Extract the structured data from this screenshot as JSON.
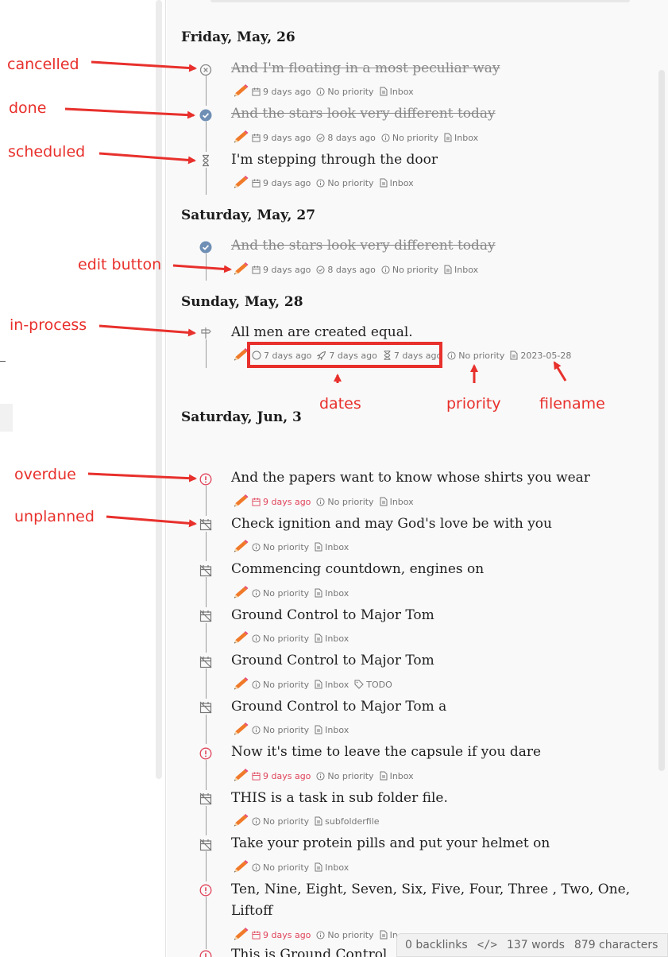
{
  "days": [
    {
      "heading": "Friday, May, 26"
    },
    {
      "heading": "Saturday, May, 27"
    },
    {
      "heading": "Sunday, May, 28"
    },
    {
      "heading": "Saturday, Jun, 3"
    }
  ],
  "tasks": [
    {
      "title": "And I'm floating in a most peculiar way",
      "status": "cancelled",
      "created": "9 days ago",
      "priority": "No priority",
      "file": "Inbox"
    },
    {
      "title": "And the stars look very different today",
      "status": "done",
      "created": "9 days ago",
      "completed": "8 days ago",
      "priority": "No priority",
      "file": "Inbox"
    },
    {
      "title": "I'm stepping through the door",
      "status": "scheduled",
      "created": "9 days ago",
      "priority": "No priority",
      "file": "Inbox"
    },
    {
      "title": "And the stars look very different today",
      "status": "done",
      "created": "9 days ago",
      "completed": "8 days ago",
      "priority": "No priority",
      "file": "Inbox"
    },
    {
      "title": "All men are created equal.",
      "status": "in-process",
      "created": "7 days ago",
      "start": "7 days ago",
      "scheduled": "7 days ago",
      "priority": "No priority",
      "file": "2023-05-28"
    },
    {
      "title": "And the papers want to know whose shirts you wear",
      "status": "overdue",
      "due": "9 days ago",
      "priority": "No priority",
      "file": "Inbox"
    },
    {
      "title": "Check ignition and may God's love be with you",
      "status": "unplanned",
      "priority": "No priority",
      "file": "Inbox"
    },
    {
      "title": "Commencing countdown, engines on",
      "status": "unplanned",
      "priority": "No priority",
      "file": "Inbox"
    },
    {
      "title": "Ground Control to Major Tom",
      "status": "unplanned",
      "priority": "No priority",
      "file": "Inbox"
    },
    {
      "title": "Ground Control to Major Tom",
      "status": "unplanned",
      "priority": "No priority",
      "file": "Inbox",
      "tag": "TODO"
    },
    {
      "title": "Ground Control to Major Tom a",
      "status": "unplanned",
      "priority": "No priority",
      "file": "Inbox"
    },
    {
      "title": "Now it's time to leave the capsule if you dare",
      "status": "overdue",
      "due": "9 days ago",
      "priority": "No priority",
      "file": "Inbox"
    },
    {
      "title": "THIS is a task in sub folder file.",
      "status": "unplanned",
      "priority": "No priority",
      "file": "subfolderfile"
    },
    {
      "title": "Take your protein pills and put your helmet on",
      "status": "unplanned",
      "priority": "No priority",
      "file": "Inbox"
    },
    {
      "title": "Ten, Nine, Eight, Seven, Six, Five, Four, Three , Two, One, Liftoff",
      "status": "overdue",
      "due": "9 days ago",
      "priority": "No priority",
      "file": "In"
    },
    {
      "title": "This is Ground Control",
      "status": "overdue"
    }
  ],
  "annotations": {
    "cancelled": "cancelled",
    "done": "done",
    "scheduled": "scheduled",
    "edit_button": "edit button",
    "in_process": "in-process",
    "dates": "dates",
    "priority": "priority",
    "filename": "filename",
    "overdue": "overdue",
    "unplanned": "unplanned"
  },
  "statusbar": {
    "backlinks": "0 backlinks",
    "code_icon": "</>",
    "words": "137 words",
    "characters": "879 characters"
  },
  "colors": {
    "annotation": "#e8302c",
    "overdue": "#e0445a",
    "done": "#6f8fb5",
    "pencil": "#f07a2a"
  },
  "icons": [
    "pencil-icon",
    "calendar-icon",
    "check-circle-icon",
    "info-icon",
    "file-icon",
    "tag-icon",
    "hourglass-icon",
    "rocket-icon",
    "circle-icon",
    "signpost-icon",
    "calendar-off-icon",
    "alert-circle-icon",
    "x-circle-icon",
    "code-icon"
  ]
}
